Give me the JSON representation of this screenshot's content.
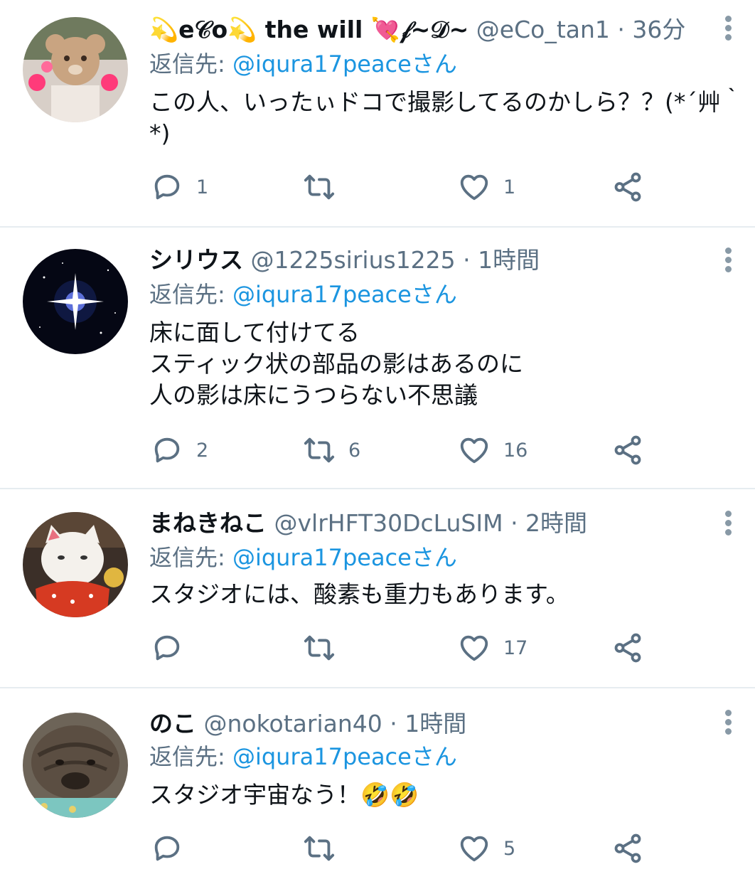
{
  "colors": {
    "link": "#1b95e0",
    "secondary": "#5b7083",
    "separator": "#e6ecf0"
  },
  "tweets": [
    {
      "display_name": "💫e𝒞o💫 the will 💘𝒻~𝒟~",
      "handle": "@eCo_tan1",
      "time": "36分",
      "reply_prefix": "返信先: ",
      "reply_to": "@iqura17peaceさん",
      "lines": [
        "この人、いったぃドコで撮影してるのかしら？？(*´艸｀",
        "*)"
      ],
      "reply_count": "1",
      "retweet_count": "",
      "like_count": "1"
    },
    {
      "display_name": "シリウス",
      "handle": "@1225sirius1225",
      "time": "1時間",
      "reply_prefix": "返信先: ",
      "reply_to": "@iqura17peaceさん",
      "lines": [
        "床に面して付けてる",
        "スティック状の部品の影はあるのに",
        "人の影は床にうつらない不思議"
      ],
      "reply_count": "2",
      "retweet_count": "6",
      "like_count": "16"
    },
    {
      "display_name": "まねきねこ",
      "handle": "@vlrHFT30DcLuSIM",
      "time": "2時間",
      "reply_prefix": "返信先: ",
      "reply_to": "@iqura17peaceさん",
      "lines": [
        "スタジオには、酸素も重力もあります。"
      ],
      "reply_count": "",
      "retweet_count": "",
      "like_count": "17"
    },
    {
      "display_name": "のこ",
      "handle": "@nokotarian40",
      "time": "1時間",
      "reply_prefix": "返信先: ",
      "reply_to": "@iqura17peaceさん",
      "lines": [
        "スタジオ宇宙なう！🤣🤣"
      ],
      "reply_count": "",
      "retweet_count": "",
      "like_count": "5"
    }
  ],
  "icons": [
    "reply-icon",
    "retweet-icon",
    "like-icon",
    "share-icon",
    "more-icon"
  ]
}
